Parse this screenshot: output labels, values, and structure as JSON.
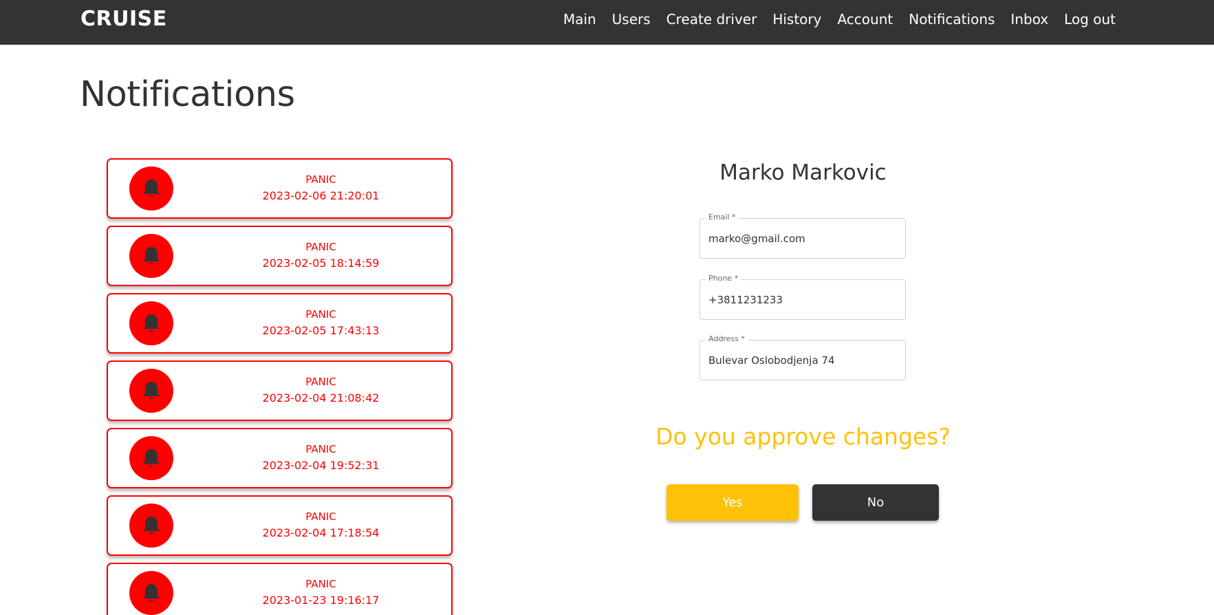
{
  "nav": {
    "brand": "CRUISE",
    "links": [
      "Main",
      "Users",
      "Create driver",
      "History",
      "Account",
      "Notifications",
      "Inbox",
      "Log out"
    ]
  },
  "page": {
    "title": "Notifications"
  },
  "notifications": [
    {
      "type": "PANIC",
      "time": "2023-02-06 21:20:01",
      "icon": "bell-icon"
    },
    {
      "type": "PANIC",
      "time": "2023-02-05 18:14:59",
      "icon": "bell-icon"
    },
    {
      "type": "PANIC",
      "time": "2023-02-05 17:43:13",
      "icon": "bell-icon"
    },
    {
      "type": "PANIC",
      "time": "2023-02-04 21:08:42",
      "icon": "bell-icon"
    },
    {
      "type": "PANIC",
      "time": "2023-02-04 19:52:31",
      "icon": "bell-icon"
    },
    {
      "type": "PANIC",
      "time": "2023-02-04 17:18:54",
      "icon": "bell-icon"
    },
    {
      "type": "PANIC",
      "time": "2023-01-23 19:16:17",
      "icon": "bell-icon"
    }
  ],
  "detail": {
    "name": "Marko Markovic",
    "email": {
      "label": "Email *",
      "value": "marko@gmail.com"
    },
    "phone": {
      "label": "Phone *",
      "value": "+3811231233"
    },
    "address": {
      "label": "Address *",
      "value": "Bulevar Oslobodjenja 74"
    },
    "question": "Do you approve changes?",
    "yes_label": "Yes",
    "no_label": "No"
  },
  "colors": {
    "navbar": "#333333",
    "panic": "#ff0000",
    "accent": "#ffc107",
    "dark_button": "#333333"
  }
}
